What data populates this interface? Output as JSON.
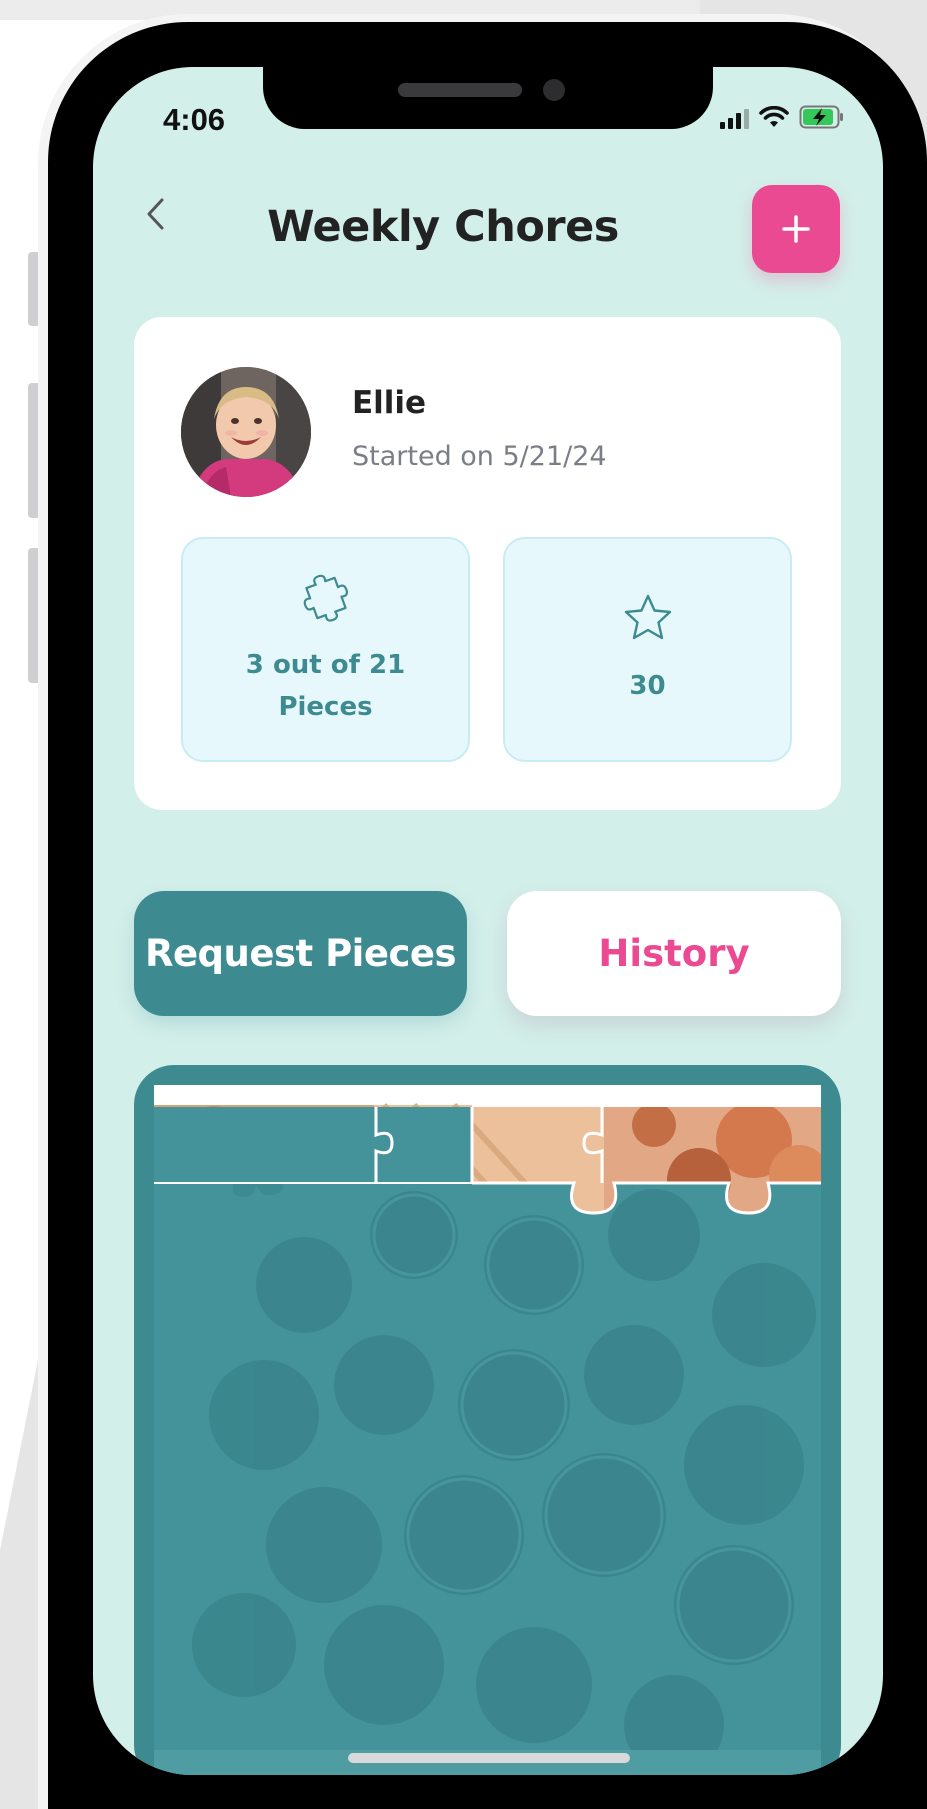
{
  "status_bar": {
    "time": "4:06",
    "signal_icon": "cellular-signal-icon",
    "wifi_icon": "wifi-icon",
    "battery_icon": "battery-charging-icon"
  },
  "header": {
    "title": "Weekly Chores",
    "back_icon": "chevron-left-icon",
    "add_icon": "plus-icon"
  },
  "profile": {
    "name": "Ellie",
    "started": "Started on 5/21/24",
    "avatar_icon": "child-avatar-photo"
  },
  "stats": {
    "pieces_icon": "puzzle-piece-icon",
    "pieces_label": "3 out of 21 Pieces",
    "stars_icon": "star-icon",
    "stars_label": "30"
  },
  "actions": {
    "request_label": "Request Pieces",
    "history_label": "History"
  },
  "puzzle": {
    "pieces_revealed": 3,
    "pieces_total": 21
  },
  "colors": {
    "background": "#d3efea",
    "primary_teal": "#3d8b90",
    "accent_pink": "#ea4a91",
    "card_white": "#ffffff",
    "stat_box": "#e7f8fc"
  }
}
